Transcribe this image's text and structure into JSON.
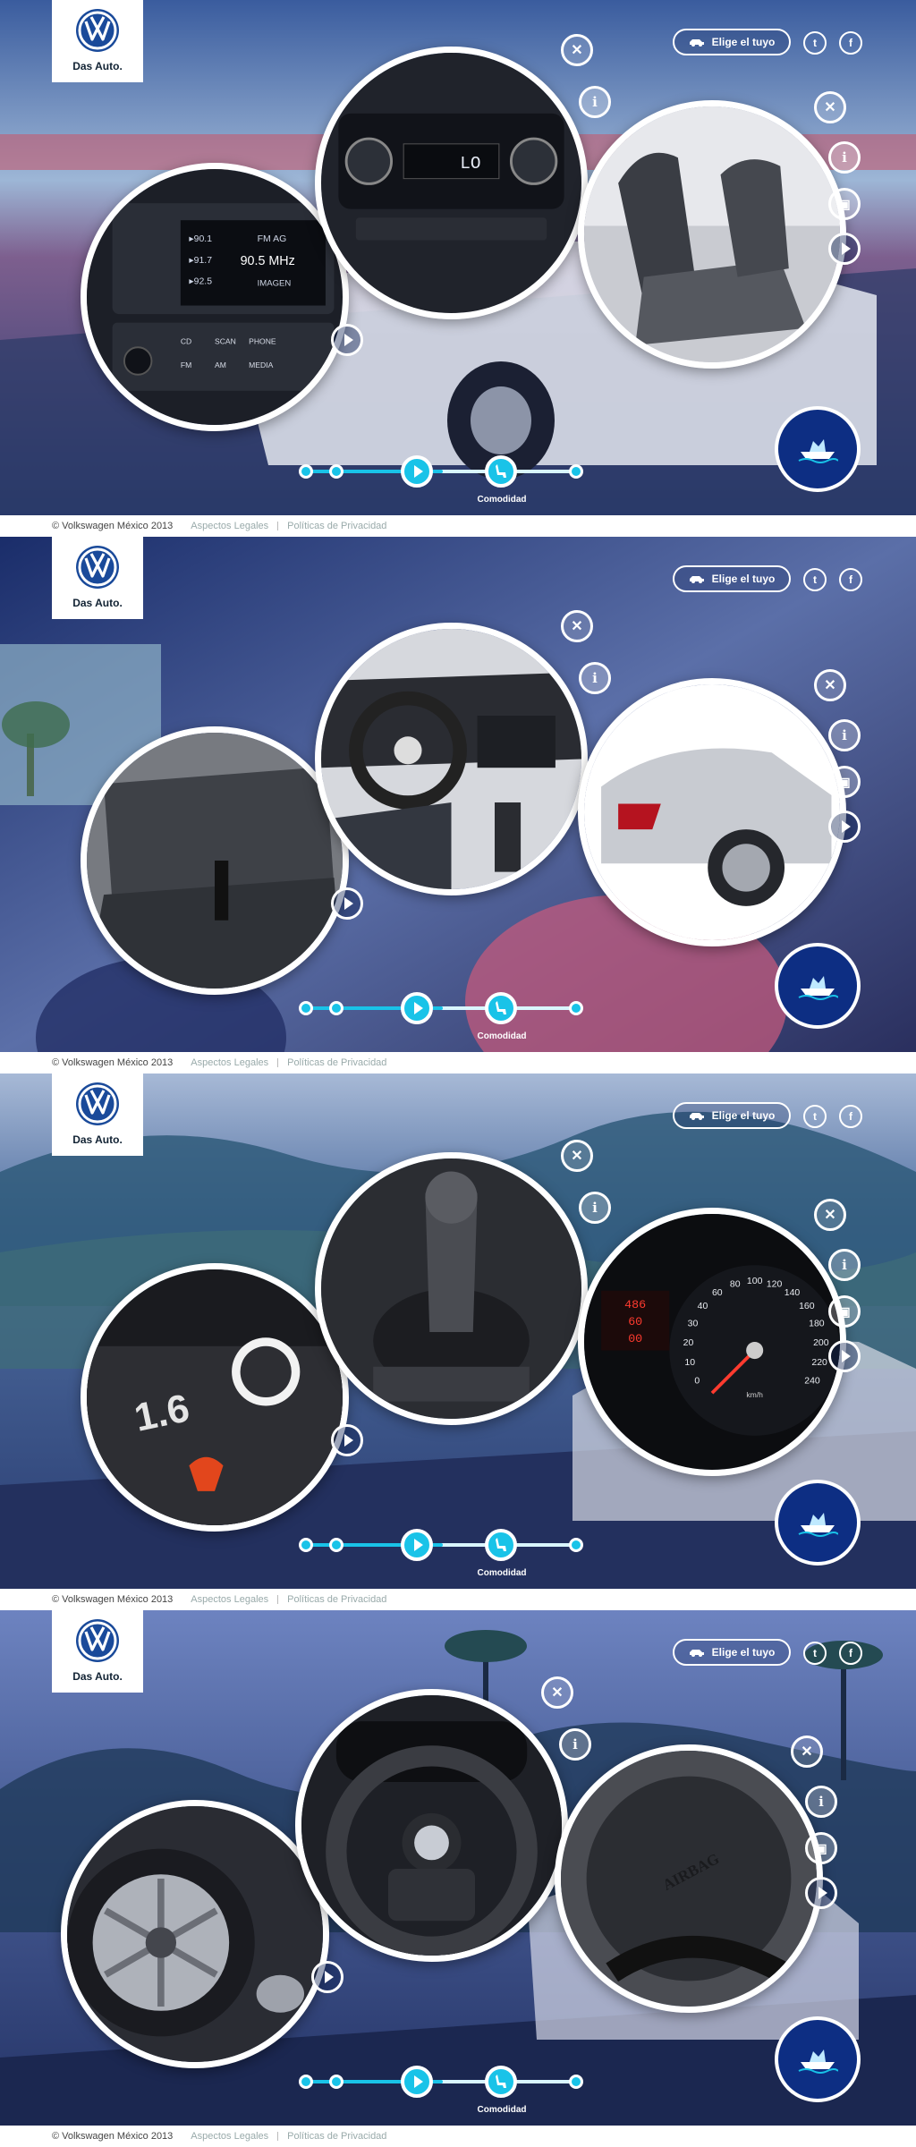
{
  "brand": {
    "tagline": "Das Auto."
  },
  "header": {
    "choose_label": "Elige el tuyo",
    "twitter_icon": "twitter-icon",
    "facebook_icon": "facebook-icon"
  },
  "footer": {
    "copyright": "© Volkswagen México 2013",
    "legal": "Aspectos Legales",
    "privacy": "Políticas de Privacidad"
  },
  "timeline": {
    "label": "Comodidad"
  },
  "panels": [
    {
      "scene": "highway-white-car",
      "circles": [
        "radio-console",
        "ac-controls",
        "front-seats"
      ],
      "radio": {
        "presets": [
          "90.1",
          "91.7",
          "92.5"
        ],
        "band": "FM AG",
        "freq": "90.5 MHz",
        "mode": "IMAGEN",
        "buttons": [
          "CD",
          "SCAN",
          "PHONE",
          "FM",
          "AM",
          "MEDIA"
        ]
      }
    },
    {
      "scene": "car-interior-people",
      "circles": [
        "rear-seats",
        "dashboard",
        "rear-exterior"
      ]
    },
    {
      "scene": "mountain-road",
      "circles": [
        "engine-1.6",
        "gear-shifter",
        "speedometer"
      ],
      "engine": {
        "badge": "1.6"
      },
      "gauge": {
        "ticks": [
          "0",
          "10",
          "20",
          "30",
          "40",
          "60",
          "80",
          "100",
          "120",
          "140",
          "160",
          "180",
          "200",
          "220",
          "240"
        ],
        "unit": "km/h",
        "lcd": [
          "486",
          "60",
          "00"
        ]
      }
    },
    {
      "scene": "palm-road",
      "circles": [
        "wheel",
        "steering-wheel",
        "airbag"
      ],
      "airbag": {
        "text": "AIRBAG"
      }
    }
  ],
  "colors": {
    "accent": "#19c3e8",
    "navy": "#0d2e83"
  }
}
